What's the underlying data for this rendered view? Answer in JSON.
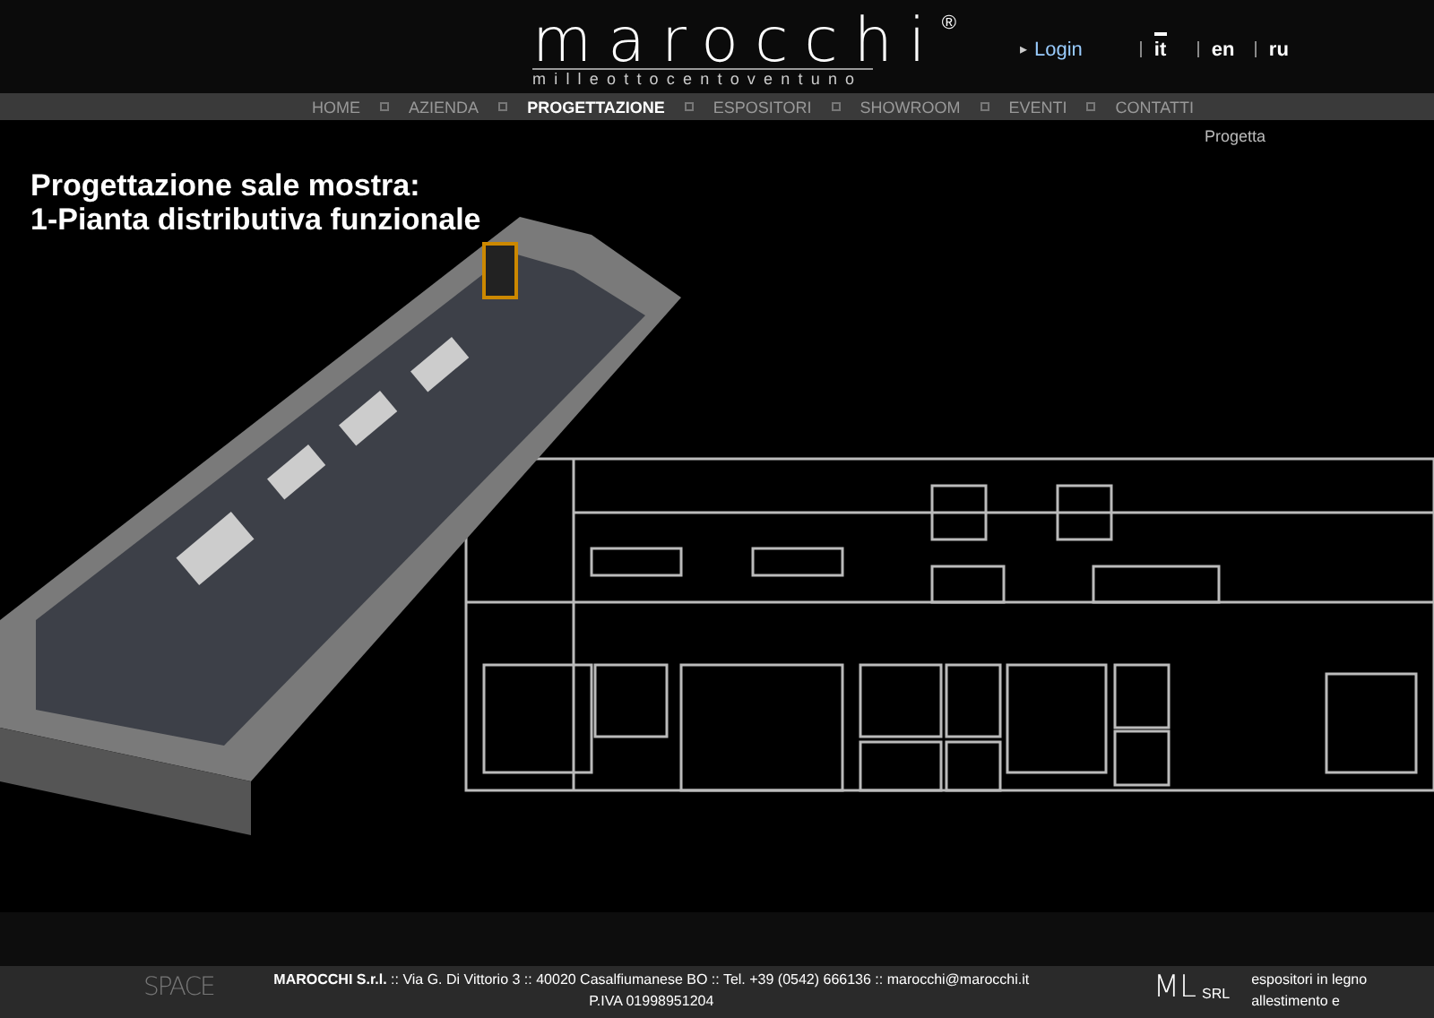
{
  "logo": {
    "name": "marocchi",
    "mark": "®",
    "tagline": "milleottocentoventuno"
  },
  "login": {
    "arrow": "▸",
    "label": "Login"
  },
  "languages": [
    {
      "label": "it",
      "selected": true
    },
    {
      "label": "en",
      "selected": false
    },
    {
      "label": "ru",
      "selected": false
    }
  ],
  "nav": [
    {
      "label": "HOME",
      "selected": false
    },
    {
      "label": "AZIENDA",
      "selected": false
    },
    {
      "label": "PROGETTAZIONE",
      "selected": true
    },
    {
      "label": "ESPOSITORI",
      "selected": false
    },
    {
      "label": "SHOWROOM",
      "selected": false
    },
    {
      "label": "EVENTI",
      "selected": false
    },
    {
      "label": "CONTATTI",
      "selected": false
    }
  ],
  "breadcrumb": "Progetta",
  "heading": [
    "Progettazione sale mostra:",
    "1-Pianta distributiva funzionale"
  ],
  "footer": {
    "left_logo": "SPACE",
    "company": "MAROCCHI S.r.l.",
    "address": " :: Via G. Di Vittorio 3 :: 40020 Casalfiumanese BO :: Tel. +39 (0542) 666136 :: marocchi@marocchi.it",
    "vat": "P.IVA 01998951204",
    "right_logo": "ML",
    "right_logo_suffix": "SRL",
    "right_text": [
      "espositori in legno",
      "allestimento e"
    ]
  }
}
